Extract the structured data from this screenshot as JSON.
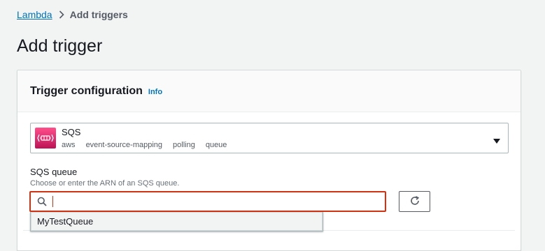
{
  "breadcrumb": {
    "root": "Lambda",
    "current": "Add triggers"
  },
  "page": {
    "title": "Add trigger"
  },
  "trigger_panel": {
    "title": "Trigger configuration",
    "info_label": "Info",
    "source_select": {
      "value": "SQS",
      "tags": [
        "aws",
        "event-source-mapping",
        "polling",
        "queue"
      ],
      "icon": "sqs-logo-icon"
    },
    "queue_field": {
      "label": "SQS queue",
      "description": "Choose or enter the ARN of an SQS queue.",
      "value": "",
      "options": [
        "MyTestQueue"
      ]
    }
  },
  "colors": {
    "link": "#0073bb",
    "error_border": "#d13212",
    "sqs_brand_top": "#ff4f8b",
    "sqs_brand_bottom": "#bc1356"
  }
}
